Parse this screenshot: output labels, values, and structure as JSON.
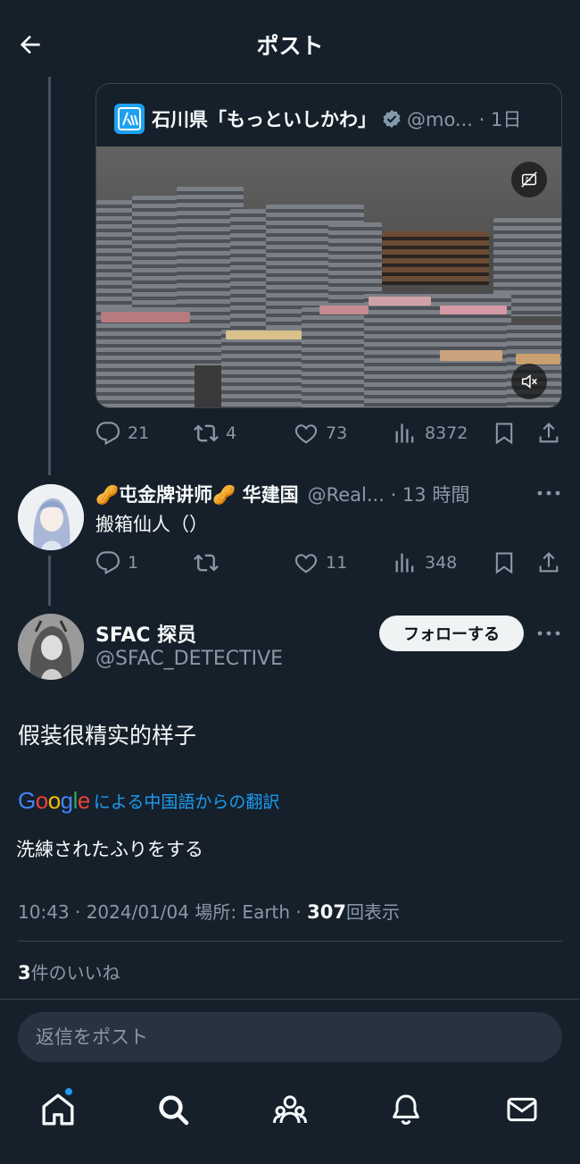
{
  "header": {
    "title": "ポスト"
  },
  "quoted_post": {
    "author_name": "石川県「もっといしかわ」",
    "handle_time": "@mo... · 1日",
    "video": {
      "muted": true
    },
    "actions": {
      "replies": "21",
      "reposts": "4",
      "likes": "73",
      "views": "8372"
    }
  },
  "reply_post": {
    "author_name": "🥜屯金牌讲师🥜 华建国",
    "handle_time": "@Real... · 13 時間",
    "text": "搬箱仙人（）",
    "actions": {
      "replies": "1",
      "reposts": "",
      "likes": "11",
      "views": "348"
    }
  },
  "main_post": {
    "author_name": "SFAC 探员",
    "handle": "@SFAC_DETECTIVE",
    "follow_label": "フォローする",
    "text": "假装很精实的样子",
    "translation_provider": "Google",
    "translation_label": "による中国語からの翻訳",
    "translated_text": "洗練されたふりをする",
    "meta_prefix": "10:43 · 2024/01/04 場所: Earth · ",
    "view_count": "307",
    "view_suffix": "回表示",
    "like_count": "3",
    "like_suffix": "件のいいね"
  },
  "reply_input": {
    "placeholder": "返信をポスト"
  },
  "nav": {
    "home_has_notification": true
  },
  "colors": {
    "background": "#15202b",
    "accent": "#1d9bf0",
    "muted": "#8b98a5",
    "border": "#38444d"
  },
  "icons": [
    "back-arrow-icon",
    "verified-badge-icon",
    "reply-icon",
    "repost-icon",
    "like-icon",
    "views-icon",
    "bookmark-icon",
    "share-icon",
    "more-icon",
    "home-icon",
    "search-icon",
    "communities-icon",
    "notifications-icon",
    "messages-icon"
  ]
}
